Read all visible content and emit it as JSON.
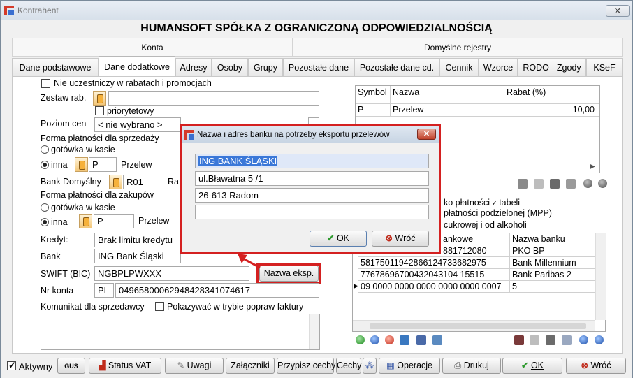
{
  "window": {
    "title": "Kontrahent",
    "close": "✕"
  },
  "heading": "HUMANSOFT SPÓŁKA Z OGRANICZONĄ ODPOWIEDZIALNOŚCIĄ",
  "groups": {
    "left": "Konta",
    "right": "Domyślne rejestry"
  },
  "tabs": [
    "Dane podstawowe",
    "Dane dodatkowe",
    "Adresy",
    "Osoby",
    "Grupy",
    "Pozostałe dane",
    "Pozostałe dane cd.",
    "Cennik",
    "Wzorce",
    "RODO - Zgody",
    "KSeF"
  ],
  "form": {
    "nie_uczestniczy": "Nie uczestniczy w rabatach i promocjach",
    "zestaw_rab": "Zestaw rab.",
    "priorytetowy": "priorytetowy",
    "poziom_cen": "Poziom cen",
    "poziom_cen_value": "< nie wybrano >",
    "forma_sprz": "Forma płatności dla sprzedaży",
    "gotowka": "gotówka w kasie",
    "inna": "inna",
    "sprz_code": "P",
    "sprz_name": "Przelew",
    "bank_domyslny": "Bank Domyślny",
    "bank_code": "R01",
    "bank_code_suffix": "Ra",
    "forma_zak": "Forma płatności dla zakupów",
    "zak_code": "P",
    "zak_name": "Przelew",
    "kredyt": "Kredyt:",
    "kredyt_value": "Brak limitu kredytu",
    "bank": "Bank",
    "bank_value": "ING Bank Śląski",
    "swift": "SWIFT (BIC)",
    "swift_value": "NGBPLPWXXX",
    "nazwa_eksp": "Nazwa eksp.",
    "nr_konta": "Nr konta",
    "nr_konta_prefix": "PL",
    "nr_konta_value": "04965800062948428341074617",
    "komunikat": "Komunikat dla sprzedawcy",
    "pokazywac": "Pokazywać w trybie popraw faktury"
  },
  "rabat_table": {
    "headers": [
      "Symbol",
      "Nazwa",
      "Rabat (%)"
    ],
    "rows": [
      [
        "P",
        "Przelew",
        "10,00"
      ]
    ]
  },
  "right_options": {
    "o1": "ko płatności z tabeli",
    "o2": "płatności podzielonej (MPP)",
    "o3": "cukrowej i od alkoholi"
  },
  "bank_table": {
    "headers": [
      "ankowe",
      "Nazwa banku"
    ],
    "rows": [
      [
        "881712080",
        "PKO BP"
      ],
      [
        "58175011942866124733682975",
        "Bank Millennium"
      ],
      [
        "77678696700432043104 15515",
        "Bank Paribas 2"
      ],
      [
        "09 0000 0000 0000 0000 0000 0007",
        "5"
      ]
    ]
  },
  "dialog": {
    "title": "Nazwa i adres banku na potrzeby eksportu przelewów",
    "line1": "ING BANK ŚLĄSKI",
    "line2": "ul.Bławatna 5 /1",
    "line3": "26-613 Radom",
    "line4": "",
    "ok": "OK",
    "cancel": "Wróć"
  },
  "bottom": {
    "aktywny": "Aktywny",
    "gus": "GUS",
    "status_vat": "Status VAT",
    "uwagi": "Uwagi",
    "zalaczniki": "Załączniki",
    "przypisz_cechy": "Przypisz cechy",
    "cechy": "Cechy",
    "operacje": "Operacje",
    "drukuj": "Drukuj",
    "ok": "OK",
    "wroc": "Wróć"
  },
  "colors": {
    "accent_red": "#d42020",
    "selection_blue": "#3b78d8",
    "ok_green": "#2f9a2f"
  }
}
